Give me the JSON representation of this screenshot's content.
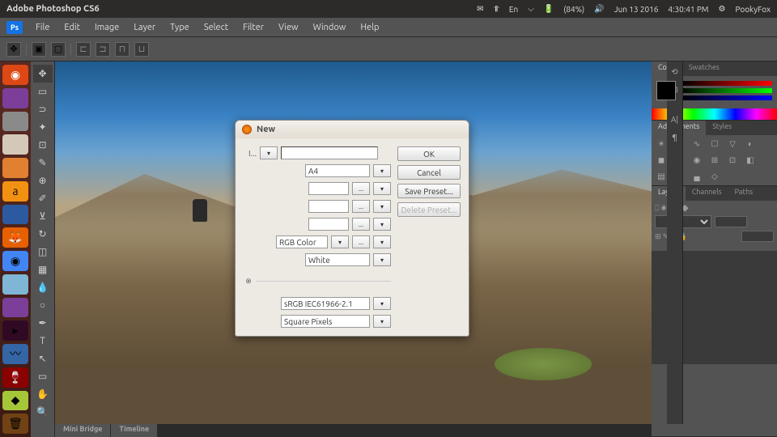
{
  "ubuntu": {
    "title": "Adobe Photoshop CS6",
    "lang": "En",
    "battery": "(84%)",
    "date": "Jun 13 2016",
    "time": "4:30:41 PM",
    "user": "PookyFox"
  },
  "menu": [
    "File",
    "Edit",
    "Image",
    "Layer",
    "Type",
    "Select",
    "Filter",
    "View",
    "Window",
    "Help"
  ],
  "bottom_tabs": [
    "Mini Bridge",
    "Timeline"
  ],
  "panels": {
    "color": {
      "tab1": "Color",
      "tab2": "Swatches"
    },
    "adjustments": {
      "tab1": "Adjustments",
      "tab2": "Styles"
    },
    "layers": {
      "tab1": "Layers",
      "tab2": "Channels",
      "tab3": "Paths"
    }
  },
  "dialog": {
    "title": "New",
    "name_label": "I...",
    "preset": "A4",
    "color_mode": "RGB Color",
    "bg": "White",
    "profile": "sRGB IEC61966-2.1",
    "pixel_aspect": "Square Pixels",
    "dots": "...",
    "btns": {
      "ok": "OK",
      "cancel": "Cancel",
      "save": "Save Preset...",
      "delete": "Delete Preset..."
    }
  }
}
